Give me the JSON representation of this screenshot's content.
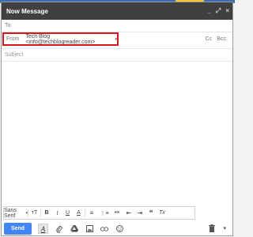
{
  "window": {
    "title": "Now Message"
  },
  "controls": {
    "minimize": "_",
    "popout": "⤢",
    "close": "×"
  },
  "to": {
    "label": "To"
  },
  "from": {
    "label": "From",
    "value": "Tech Blog <info@techblogreader.com>",
    "caret": "▾"
  },
  "recipients": {
    "cc": "Cc",
    "bcc": "Bcc"
  },
  "subject": {
    "placeholder": "Subject"
  },
  "formatting": {
    "font": "Sans Serif",
    "font_caret": "▾",
    "size": "ᴛT",
    "bold": "B",
    "italic": "I",
    "underline": "U",
    "text_color": "A",
    "align": "≡",
    "numbered_list": "⋮≡",
    "bulleted_list": "•≡",
    "indent_less": "⇤",
    "indent_more": "⇥",
    "quote": "❝",
    "remove_format": "Tx"
  },
  "bottom": {
    "send": "Send",
    "format_toggle": "A",
    "more": "▾"
  }
}
